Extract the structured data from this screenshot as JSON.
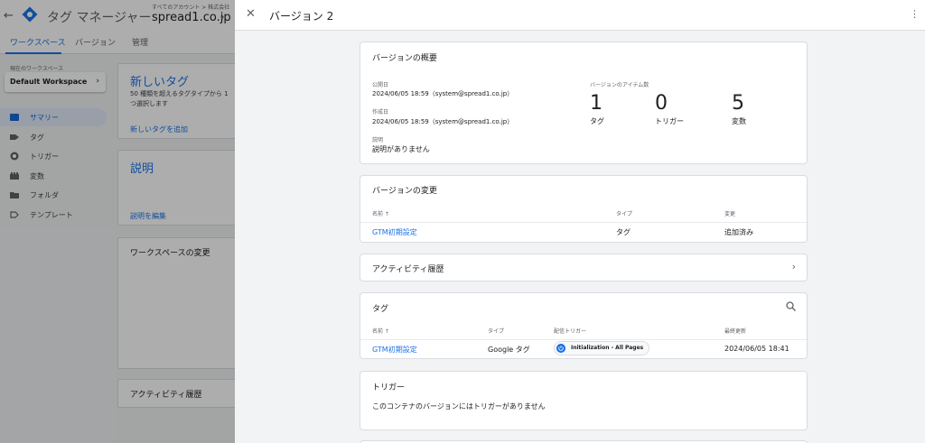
{
  "app": {
    "back": "←",
    "title": "タグ マネージャー",
    "breadcrumb": "すべてのアカウント > 株式会社",
    "container": "spread1.co.jp",
    "caret": "▾"
  },
  "tabs": [
    {
      "label": "ワークスペース",
      "active": true
    },
    {
      "label": "バージョン",
      "active": false
    },
    {
      "label": "管理",
      "active": false
    }
  ],
  "workspace": {
    "label": "現在のワークスペース",
    "name": "Default Workspace",
    "chevron": "›"
  },
  "sidebar": {
    "items": [
      {
        "label": "サマリー",
        "icon": "summary-icon",
        "active": true
      },
      {
        "label": "タグ",
        "icon": "tag-icon",
        "active": false
      },
      {
        "label": "トリガー",
        "icon": "trigger-icon",
        "active": false
      },
      {
        "label": "変数",
        "icon": "variables-icon",
        "active": false
      },
      {
        "label": "フォルダ",
        "icon": "folder-icon",
        "active": false
      },
      {
        "label": "テンプレート",
        "icon": "template-icon",
        "active": false
      }
    ]
  },
  "overview": {
    "new_tag": {
      "title": "新しいタグ",
      "body_1": "50 種類を超えるタグタイプから 1",
      "body_2": "つ選択します",
      "link": "新しいタグを追加"
    },
    "description": {
      "title": "説明",
      "link": "説明を編集"
    },
    "workspace_changes": {
      "title": "ワークスペースの変更"
    },
    "activity": {
      "title": "アクティビティ履歴"
    }
  },
  "panel": {
    "close": "✕",
    "title": "バージョン 2",
    "kebab": "⋮",
    "summary": {
      "title": "バージョンの概要",
      "published_label": "公開日",
      "published_value": "2024/06/05 18:59（system@spread1.co.jp）",
      "created_label": "作成日",
      "created_value": "2024/06/05 18:59（system@spread1.co.jp）",
      "description_label": "説明",
      "description_value": "説明がありません",
      "items_label": "バージョンのアイテム数",
      "counts": [
        {
          "value": "1",
          "label": "タグ"
        },
        {
          "value": "0",
          "label": "トリガー"
        },
        {
          "value": "5",
          "label": "変数"
        }
      ]
    },
    "changes": {
      "title": "バージョンの変更",
      "headers": {
        "name": "名前 ↑",
        "type": "タイプ",
        "change": "変更"
      },
      "rows": [
        {
          "name": "GTM初期設定",
          "type": "タグ",
          "change": "追加済み"
        }
      ]
    },
    "activity": {
      "title": "アクティビティ履歴",
      "chevron": "›"
    },
    "tags": {
      "title": "タグ",
      "headers": {
        "name": "名前 ↑",
        "type": "タイプ",
        "trigger": "配信トリガー",
        "updated": "最終更新"
      },
      "rows": [
        {
          "name": "GTM初期設定",
          "type": "Google タグ",
          "trigger": "Initialization - All Pages",
          "updated": "2024/06/05 18:41"
        }
      ]
    },
    "triggers": {
      "title": "トリガー",
      "empty": "このコンテナのバージョンにはトリガーがありません"
    }
  },
  "colors": {
    "accent": "#1a73e8",
    "active_nav_bg": "#e1ebfa"
  }
}
